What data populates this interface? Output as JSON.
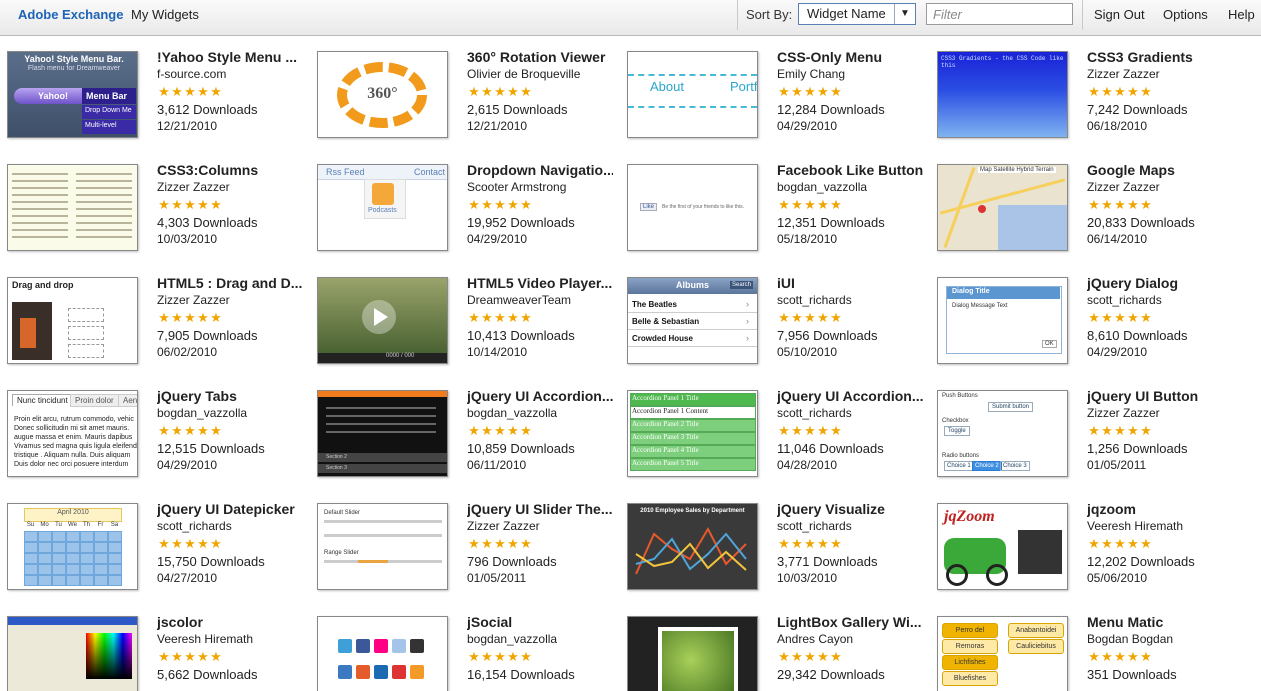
{
  "toolbar": {
    "brand": "Adobe Exchange",
    "my_widgets": "My Widgets",
    "sort_label": "Sort By:",
    "sort_value": "Widget Name",
    "filter_placeholder": "Filter",
    "sign_out": "Sign Out",
    "options": "Options",
    "help": "Help"
  },
  "widgets": [
    {
      "title": "!Yahoo Style Menu ...",
      "author": "f-source.com",
      "rating": 5,
      "downloads": "3,612 Downloads",
      "date": "12/21/2010",
      "thumb": "yahoo-menu",
      "thumb_text": [
        "Yahoo! Style Menu Bar.",
        "Flash menu for Dreamweaver",
        "Yahoo!",
        "Menu Bar",
        "Drop Down Me",
        "Multi-level"
      ]
    },
    {
      "title": "360° Rotation Viewer",
      "author": "Olivier de Broqueville",
      "rating": 5,
      "downloads": "2,615 Downloads",
      "date": "12/21/2010",
      "thumb": "rotation",
      "thumb_text": [
        "360°"
      ]
    },
    {
      "title": "CSS-Only Menu",
      "author": "Emily Chang",
      "rating": 5,
      "downloads": "12,284 Downloads",
      "date": "04/29/2010",
      "thumb": "css-menu",
      "thumb_text": [
        "About",
        "Portfi"
      ]
    },
    {
      "title": "CSS3 Gradients",
      "author": "Zizzer Zazzer",
      "rating": 5,
      "downloads": "7,242 Downloads",
      "date": "06/18/2010",
      "thumb": "gradients",
      "thumb_text": [
        "CSS3 Gradients - the CSS Code like this"
      ]
    },
    {
      "title": "CSS3:Columns",
      "author": "Zizzer Zazzer",
      "rating": 5,
      "downloads": "4,303 Downloads",
      "date": "10/03/2010",
      "thumb": "columns",
      "thumb_text": []
    },
    {
      "title": "Dropdown Navigatio...",
      "author": "Scooter Armstrong",
      "rating": 5,
      "downloads": "19,952 Downloads",
      "date": "04/29/2010",
      "thumb": "dropdown",
      "thumb_text": [
        "Rss Feed",
        "Contact",
        "Podcasts"
      ]
    },
    {
      "title": "Facebook Like Button",
      "author": "bogdan_vazzolla",
      "rating": 5,
      "downloads": "12,351 Downloads",
      "date": "05/18/2010",
      "thumb": "facebook",
      "thumb_text": [
        "Like",
        "Be the first of your friends to like this."
      ]
    },
    {
      "title": "Google Maps",
      "author": "Zizzer Zazzer",
      "rating": 5,
      "downloads": "20,833 Downloads",
      "date": "06/14/2010",
      "thumb": "maps",
      "thumb_text": [
        "Map",
        "Satellite",
        "Hybrid",
        "Terrain"
      ]
    },
    {
      "title": "HTML5 : Drag and D...",
      "author": "Zizzer Zazzer",
      "rating": 5,
      "downloads": "7,905 Downloads",
      "date": "06/02/2010",
      "thumb": "dragdrop",
      "thumb_text": [
        "Drag and drop"
      ]
    },
    {
      "title": "HTML5 Video Player...",
      "author": "DreamweaverTeam",
      "rating": 5,
      "downloads": "10,413 Downloads",
      "date": "10/14/2010",
      "thumb": "video",
      "thumb_text": [
        "0000 / 000"
      ]
    },
    {
      "title": "iUI",
      "author": "scott_richards",
      "rating": 5,
      "downloads": "7,956 Downloads",
      "date": "05/10/2010",
      "thumb": "iui",
      "thumb_text": [
        "Albums",
        "Search",
        "The Beatles",
        "Belle & Sebastian",
        "Crowded House"
      ]
    },
    {
      "title": "jQuery Dialog",
      "author": "scott_richards",
      "rating": 5,
      "downloads": "8,610 Downloads",
      "date": "04/29/2010",
      "thumb": "dialog",
      "thumb_text": [
        "Dialog Title",
        "Dialog Message Text",
        "OK"
      ]
    },
    {
      "title": "jQuery Tabs",
      "author": "bogdan_vazzolla",
      "rating": 5,
      "downloads": "12,515 Downloads",
      "date": "04/29/2010",
      "thumb": "tabs",
      "thumb_text": [
        "Nunc tincidunt",
        "Proin dolor",
        "Aenea",
        "Proin elit arcu, rutrum commodo, vehic",
        "Donec sollicitudin mi sit amet mauris.",
        "augue massa et enim. Mauris dapibus",
        "Vivamus sed magna quis ligula eleifend",
        "tristique . Aliquam nulla. Duis aliquam",
        "Duis dolor nec orci posuere interdum"
      ]
    },
    {
      "title": "jQuery UI Accordion...",
      "author": "bogdan_vazzolla",
      "rating": 5,
      "downloads": "10,859 Downloads",
      "date": "06/11/2010",
      "thumb": "accordion-dark",
      "thumb_text": [
        "Section 2",
        "Section 3"
      ]
    },
    {
      "title": "jQuery UI Accordion...",
      "author": "scott_richards",
      "rating": 5,
      "downloads": "11,046 Downloads",
      "date": "04/28/2010",
      "thumb": "accordion-green",
      "thumb_text": [
        "Accordion Panel 1 Title",
        "Accordion Panel 1 Content",
        "Accordion Panel 2 Title",
        "Accordion Panel 3 Title",
        "Accordion Panel 4 Title",
        "Accordion Panel 5 Title"
      ]
    },
    {
      "title": "jQuery UI Button",
      "author": "Zizzer Zazzer",
      "rating": 5,
      "downloads": "1,256 Downloads",
      "date": "01/05/2011",
      "thumb": "buttons",
      "thumb_text": [
        "Push Buttons",
        "Submit button",
        "Checkbox",
        "Toggle",
        "Radio buttons",
        "Choice 1",
        "Choice 2",
        "Choice 3"
      ]
    },
    {
      "title": "jQuery UI Datepicker",
      "author": "scott_richards",
      "rating": 5,
      "downloads": "15,750 Downloads",
      "date": "04/27/2010",
      "thumb": "datepicker",
      "thumb_text": [
        "April 2010",
        "Su",
        "Mo",
        "Tu",
        "We",
        "Th",
        "Fr",
        "Sa"
      ]
    },
    {
      "title": "jQuery UI Slider The...",
      "author": "Zizzer Zazzer",
      "rating": 5,
      "downloads": "796 Downloads",
      "date": "01/05/2011",
      "thumb": "slider",
      "thumb_text": [
        "Default Slider",
        "Range Slider"
      ]
    },
    {
      "title": "jQuery Visualize",
      "author": "scott_richards",
      "rating": 5,
      "downloads": "3,771 Downloads",
      "date": "10/03/2010",
      "thumb": "visualize",
      "thumb_text": [
        "2010 Employee Sales by Department"
      ]
    },
    {
      "title": "jqzoom",
      "author": "Veeresh Hiremath",
      "rating": 5,
      "downloads": "12,202 Downloads",
      "date": "05/06/2010",
      "thumb": "jqzoom",
      "thumb_text": [
        "jqZoom"
      ]
    },
    {
      "title": "jscolor",
      "author": "Veeresh Hiremath",
      "rating": 5,
      "downloads": "5,662 Downloads",
      "date": "",
      "thumb": "jscolor",
      "thumb_text": []
    },
    {
      "title": "jSocial",
      "author": "bogdan_vazzolla",
      "rating": 5,
      "downloads": "16,154 Downloads",
      "date": "",
      "thumb": "jsocial",
      "thumb_text": []
    },
    {
      "title": "LightBox Gallery Wi...",
      "author": "Andres Cayon",
      "rating": 5,
      "downloads": "29,342 Downloads",
      "date": "",
      "thumb": "lightbox",
      "thumb_text": []
    },
    {
      "title": "Menu Matic",
      "author": "Bogdan Bogdan",
      "rating": 5,
      "downloads": "351 Downloads",
      "date": "",
      "thumb": "menumatic",
      "thumb_text": [
        "Perro del",
        "Anabantoidei",
        "Remoras",
        "Lichfishes",
        "Cauliciebitus",
        "Bluefishes"
      ]
    }
  ]
}
